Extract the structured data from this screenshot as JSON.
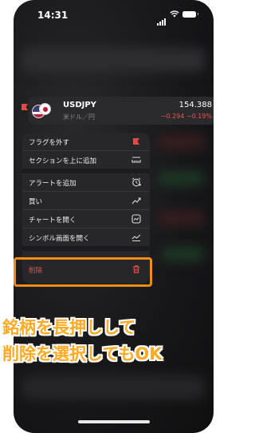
{
  "status_bar": {
    "time": "14:31"
  },
  "ticker": {
    "symbol": "USDJPY",
    "subtitle": "米ドル／円",
    "price": "154.388",
    "change": "−0.294  −0.19%"
  },
  "menu": {
    "items": [
      {
        "label": "フラグを外す",
        "icon": "flag-icon"
      },
      {
        "label": "セクションを上に追加",
        "icon": "section-add-icon"
      },
      {
        "label": "アラートを追加",
        "icon": "alarm-plus-icon"
      },
      {
        "label": "買い",
        "icon": "buy-trend-icon"
      },
      {
        "label": "チャートを開く",
        "icon": "chart-icon"
      },
      {
        "label": "シンボル画面を開く",
        "icon": "symbol-screen-icon"
      },
      {
        "label": "削除",
        "icon": "trash-icon"
      }
    ]
  },
  "caption": {
    "line1": "銘柄を長押しして",
    "line2": "削除を選択してもOK"
  },
  "colors": {
    "accent_orange": "#f08d1a",
    "caption_text": "#ffaa24",
    "negative": "#f0504a",
    "flag_red": "#e24a45"
  }
}
